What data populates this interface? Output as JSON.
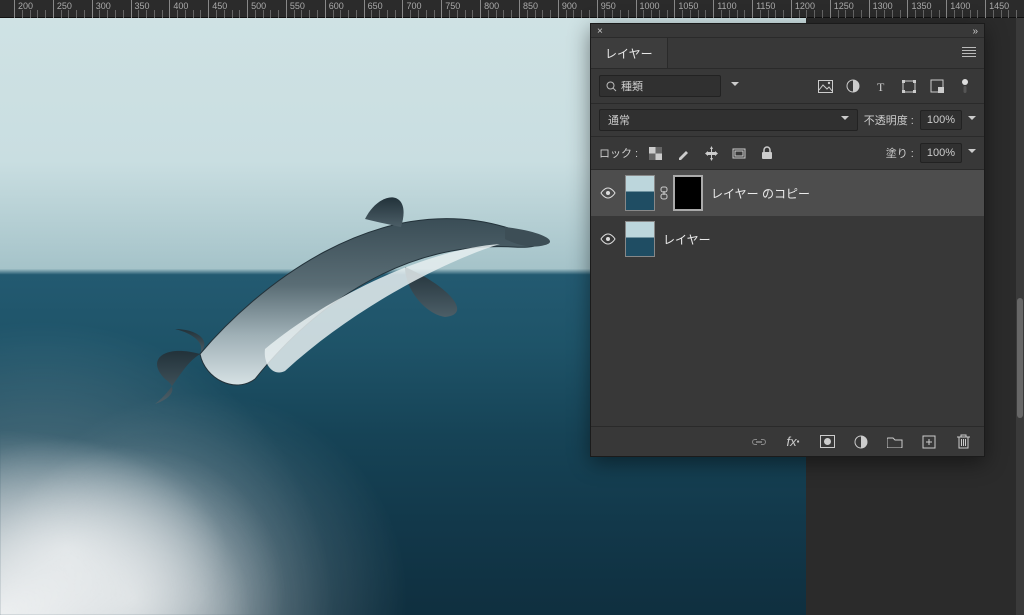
{
  "ruler": {
    "start": 200,
    "step": 50,
    "end": 1500
  },
  "panel": {
    "title": "レイヤー",
    "search_placeholder": "種類",
    "filter_icons": [
      "image-icon",
      "adjustment-icon",
      "type-icon",
      "shape-icon",
      "smartobject-icon",
      "dot-icon"
    ],
    "blend_mode_label": "通常",
    "opacity_label": "不透明度 :",
    "opacity_value": "100%",
    "lock_label": "ロック :",
    "fill_label": "塗り :",
    "fill_value": "100%",
    "layers": [
      {
        "visible": true,
        "has_mask": true,
        "selected": true,
        "name": "レイヤー のコピー"
      },
      {
        "visible": true,
        "has_mask": false,
        "selected": false,
        "name": "レイヤー"
      }
    ],
    "footer_icons": [
      "link-icon",
      "fx-icon",
      "mask-icon",
      "adjustment-circle-icon",
      "folder-icon",
      "new-layer-icon",
      "trash-icon"
    ]
  }
}
